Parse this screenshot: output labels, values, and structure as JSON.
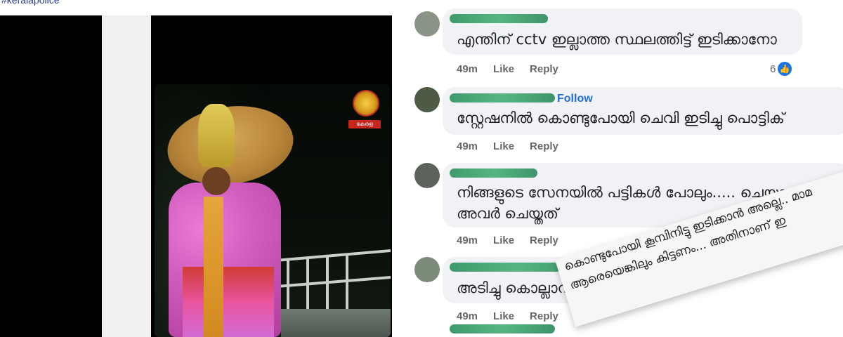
{
  "post": {
    "hashtag": "#keralapolice",
    "emblem_tag": "കേരള പോലീസ്"
  },
  "comments": [
    {
      "text": "എന്തിന് cctv ഇല്ലാത്ത സ്ഥലത്തിട്ട് ഇടിക്കാനോ",
      "time": "49m",
      "like_label": "Like",
      "reply_label": "Reply",
      "reaction_count": "6",
      "reaction_icon": "like-icon"
    },
    {
      "text": "സ്റ്റേഷനിൽ കൊണ്ടുപോയി ചെവി ഇടിച്ചു പൊട്ടിക്",
      "time": "49m",
      "like_label": "Like",
      "reply_label": "Reply",
      "follow_label": "Follow"
    },
    {
      "text_line1": "നിങ്ങളുടെ സേനയിൽ പട്ടികൾ പോലും..... ചെയ്യാ",
      "text_line2": "അവർ ചെയ്തത്",
      "time": "49m",
      "like_label": "Like",
      "reply_label": "Reply"
    },
    {
      "text": "അടിച്ചു കൊല്ലാനാ",
      "time": "49m",
      "like_label": "Like",
      "reply_label": "Reply"
    }
  ],
  "overlay_comment": {
    "line1": "കൊണ്ടുപോയി കൂമ്പിനിട്ടു ഇടിക്കാൻ അല്ലെ.. മാമ",
    "line2": "ആരെയെങ്കിലും കിട്ടണം... അതിനാണ് ഇ"
  },
  "colors": {
    "facebook_blue": "#1b74e4",
    "bubble_gray": "#f0f2f5",
    "meta_gray": "#65676b",
    "redaction_green": "#57b482"
  }
}
